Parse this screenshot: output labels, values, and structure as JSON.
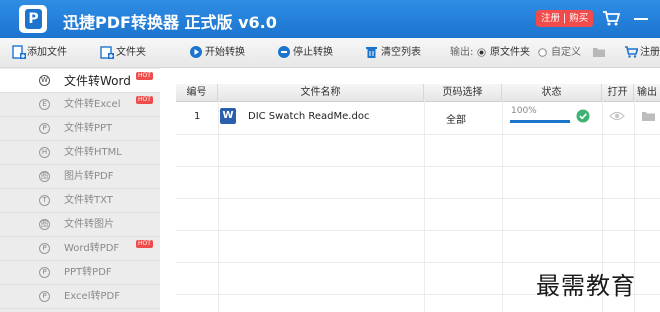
{
  "titlebar": {
    "logo_letter": "P",
    "title": "迅捷PDF转换器 正式版 v6.0",
    "register_label": "注册 | 购买"
  },
  "toolbar": {
    "add_file": "添加文件",
    "folder": "文件夹",
    "start": "开始转换",
    "stop": "停止转换",
    "clear": "清空列表",
    "output_label": "输出:",
    "original_folder": "原文件夹",
    "custom": "自定义",
    "register": "注册"
  },
  "sidebar": {
    "items": [
      {
        "label": "文件转Word",
        "icon": "W",
        "hot": "HOT",
        "active": true
      },
      {
        "label": "文件转Excel",
        "icon": "E",
        "hot": "HOT",
        "active": false
      },
      {
        "label": "文件转PPT",
        "icon": "P",
        "hot": "",
        "active": false
      },
      {
        "label": "文件转HTML",
        "icon": "H",
        "hot": "",
        "active": false
      },
      {
        "label": "图片转PDF",
        "icon": "图",
        "hot": "",
        "active": false
      },
      {
        "label": "文件转TXT",
        "icon": "T",
        "hot": "",
        "active": false
      },
      {
        "label": "文件转图片",
        "icon": "图",
        "hot": "",
        "active": false
      },
      {
        "label": "Word转PDF",
        "icon": "P",
        "hot": "HOT",
        "active": false
      },
      {
        "label": "PPT转PDF",
        "icon": "P",
        "hot": "",
        "active": false
      },
      {
        "label": "Excel转PDF",
        "icon": "P",
        "hot": "",
        "active": false
      }
    ]
  },
  "table": {
    "headers": {
      "num": "编号",
      "name": "文件名称",
      "pages": "页码选择",
      "status": "状态",
      "open": "打开",
      "output": "输出"
    },
    "rows": [
      {
        "num": "1",
        "file_icon": "W",
        "name": "DIC Swatch ReadMe.doc",
        "pages": "全部",
        "progress_text": "100%",
        "progress": 1.0
      }
    ]
  },
  "watermark": "最需教育",
  "colors": {
    "brand_blue": "#1c74cf",
    "hot_red": "#f14c4c",
    "done_green": "#3cb371"
  }
}
